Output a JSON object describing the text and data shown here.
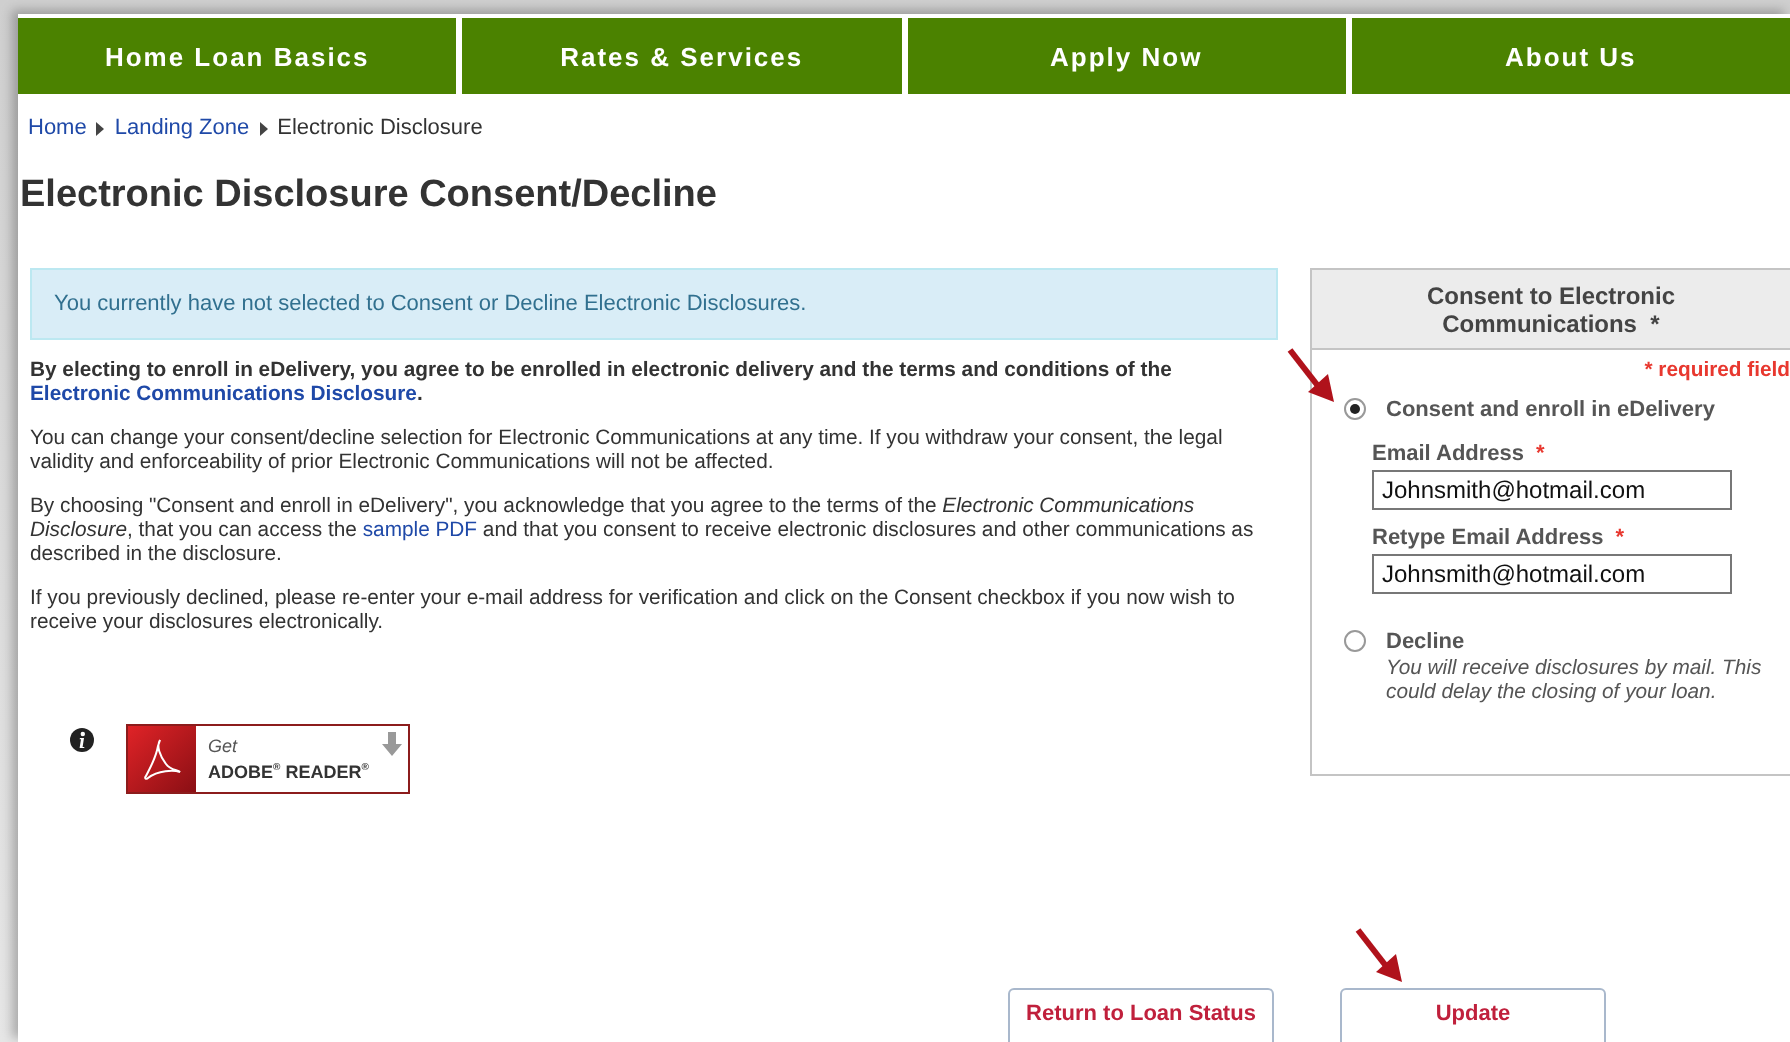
{
  "nav": [
    {
      "label": "Home Loan Basics"
    },
    {
      "label": "Rates & Services"
    },
    {
      "label": "Apply Now"
    },
    {
      "label": "About Us"
    }
  ],
  "breadcrumb": [
    {
      "label": "Home",
      "kind": "link"
    },
    {
      "label": "Landing Zone",
      "kind": "link"
    },
    {
      "label": "Electronic Disclosure",
      "kind": "current"
    }
  ],
  "title": "Electronic Disclosure Consent/Decline",
  "notice": "You currently have not selected to Consent or Decline Electronic Disclosures.",
  "paragraphs": [
    {
      "kind": "lead",
      "parts": [
        {
          "kind": "text",
          "text": "By electing to enroll in eDelivery, you agree to be enrolled in electronic delivery and the terms and conditions of the "
        },
        {
          "kind": "link",
          "text": "Electronic Communications Disclosure"
        },
        {
          "kind": "text",
          "text": "."
        }
      ]
    },
    {
      "kind": "body",
      "parts": [
        {
          "kind": "text",
          "text": "You can change your consent/decline selection for Electronic Communications at any time. If you withdraw your consent, the legal validity and enforceability of prior Electronic Communications will not be affected."
        }
      ]
    },
    {
      "kind": "body",
      "parts": [
        {
          "kind": "text",
          "text": "By choosing \"Consent and enroll in eDelivery\", you acknowledge that you agree to the terms of the *Electronic Communications Disclosure*, that you can access the "
        },
        {
          "kind": "link",
          "text": "sample PDF"
        },
        {
          "kind": "text",
          "text": " and that you consent to receive electronic disclosures and other communications as described in the disclosure."
        }
      ]
    },
    {
      "kind": "body",
      "parts": [
        {
          "kind": "text",
          "text": "If you previously declined, please re-enter your e-mail address for verification and click on the Consent checkbox if you now wish to receive your disclosures electronically."
        }
      ]
    }
  ],
  "adobe_badge": {
    "line_1": "Get",
    "line_2": "ADOBE$^{®}$ READER$^{®}$"
  },
  "consent_panel": {
    "title": "Consent to Electronic Communications",
    "required_mark": "*",
    "required_note": "* required field",
    "options": [
      {
        "label": "Consent and enroll in eDelivery",
        "selected": true,
        "fields": [
          {
            "label": "Email Address",
            "required_mark": "*",
            "value": "Johnsmith@hotmail.com"
          },
          {
            "label": "Retype Email Address",
            "required_mark": "*",
            "value": "Johnsmith@hotmail.com"
          }
        ]
      },
      {
        "label": "Decline",
        "selected": false,
        "note": "You will receive disclosures by mail. This could delay the closing of your loan."
      }
    ]
  },
  "buttons": [
    {
      "label": "Return to Loan Status"
    },
    {
      "label": "Update"
    }
  ]
}
